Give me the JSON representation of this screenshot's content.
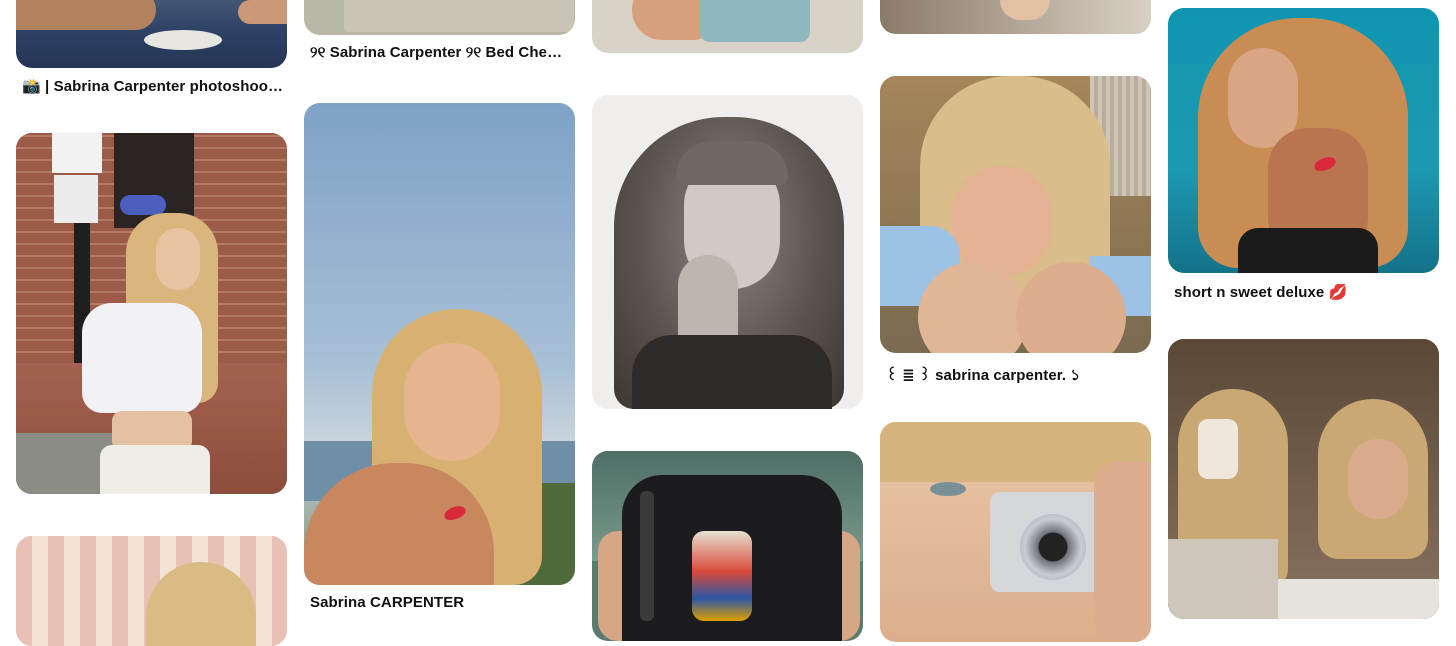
{
  "captions": {
    "c1": "📸 | Sabrina Carpenter photoshoot…",
    "c2": "୨୧ Sabrina Carpenter ୨୧ Bed Chem…",
    "c3": "Sabrina CARPENTER",
    "c4": "꒰ ≣ ꒱ sabrina carpenter. ১",
    "c5": "short n sweet deluxe 💋"
  },
  "colors": {
    "background": "#ffffff",
    "caption_text": "#111111"
  }
}
